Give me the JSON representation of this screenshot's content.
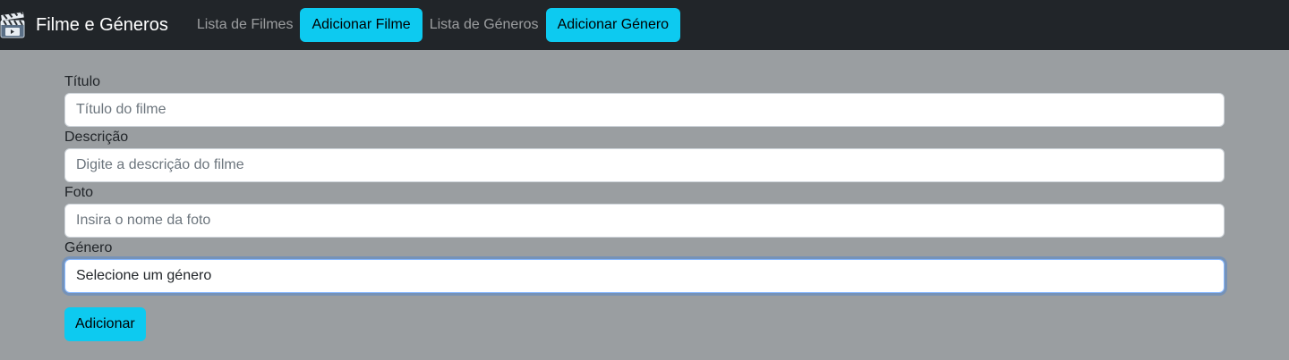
{
  "navbar": {
    "logo_icon": "film-clapperboard-icon",
    "brand_title": "Filme e Géneros",
    "links": [
      {
        "label": "Lista de Filmes",
        "type": "link"
      },
      {
        "label": "Adicionar Filme",
        "type": "button"
      },
      {
        "label": "Lista de Géneros",
        "type": "link"
      },
      {
        "label": "Adicionar Género",
        "type": "button"
      }
    ]
  },
  "form": {
    "titulo": {
      "label": "Título",
      "placeholder": "Título do filme"
    },
    "descricao": {
      "label": "Descrição",
      "placeholder": "Digite a descrição do filme"
    },
    "foto": {
      "label": "Foto",
      "placeholder": "Insira o nome da foto"
    },
    "genero": {
      "label": "Género",
      "selected": "Selecione um género"
    },
    "submit_label": "Adicionar"
  },
  "colors": {
    "navbar_bg": "#212529",
    "page_bg": "#9a9ea1",
    "accent": "#0dcaf0"
  }
}
